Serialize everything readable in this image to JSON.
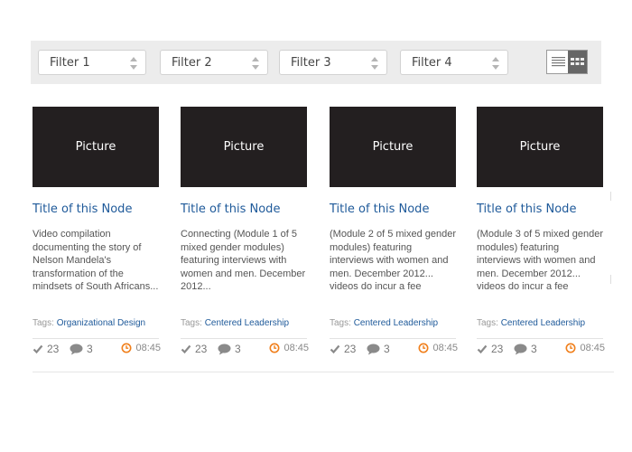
{
  "filters": [
    {
      "label": "Filter 1"
    },
    {
      "label": "Filter 2"
    },
    {
      "label": "Filter 3"
    },
    {
      "label": "Filter 4"
    }
  ],
  "view_toggle": {
    "options": [
      "list-view",
      "grid-view"
    ],
    "selected": "grid-view"
  },
  "cards": [
    {
      "picture": "Picture",
      "title": "Title of this Node",
      "description": "Video compilation documenting the story of Nelson Mandela's transformation of the mindsets of South Africans...",
      "tags_label": "Tags:",
      "tag": "Organizational Design",
      "likes": "23",
      "comments": "3",
      "time": "08:45"
    },
    {
      "picture": "Picture",
      "title": "Title of this Node",
      "description": "Connecting (Module 1 of 5 mixed gender modules) featuring interviews with women and men. December 2012...",
      "tags_label": "Tags:",
      "tag": "Centered Leadership",
      "likes": "23",
      "comments": "3",
      "time": "08:45"
    },
    {
      "picture": "Picture",
      "title": "Title of this Node",
      "description": "(Module 2 of 5 mixed gender modules) featuring interviews with women and men. December 2012... videos do incur a fee",
      "tags_label": "Tags:",
      "tag": "Centered Leadership",
      "likes": "23",
      "comments": "3",
      "time": "08:45"
    },
    {
      "picture": "Picture",
      "title": "Title of this Node",
      "description": "(Module 3 of 5 mixed gender modules) featuring interviews with women and men. December 2012... videos do incur a fee",
      "tags_label": "Tags:",
      "tag": "Centered Leadership",
      "likes": "23",
      "comments": "3",
      "time": "08:45"
    }
  ],
  "colors": {
    "link": "#1f5a9a",
    "picture_bg": "#231f20",
    "clock": "#f07f1b",
    "filter_bar_bg": "#ececec"
  }
}
